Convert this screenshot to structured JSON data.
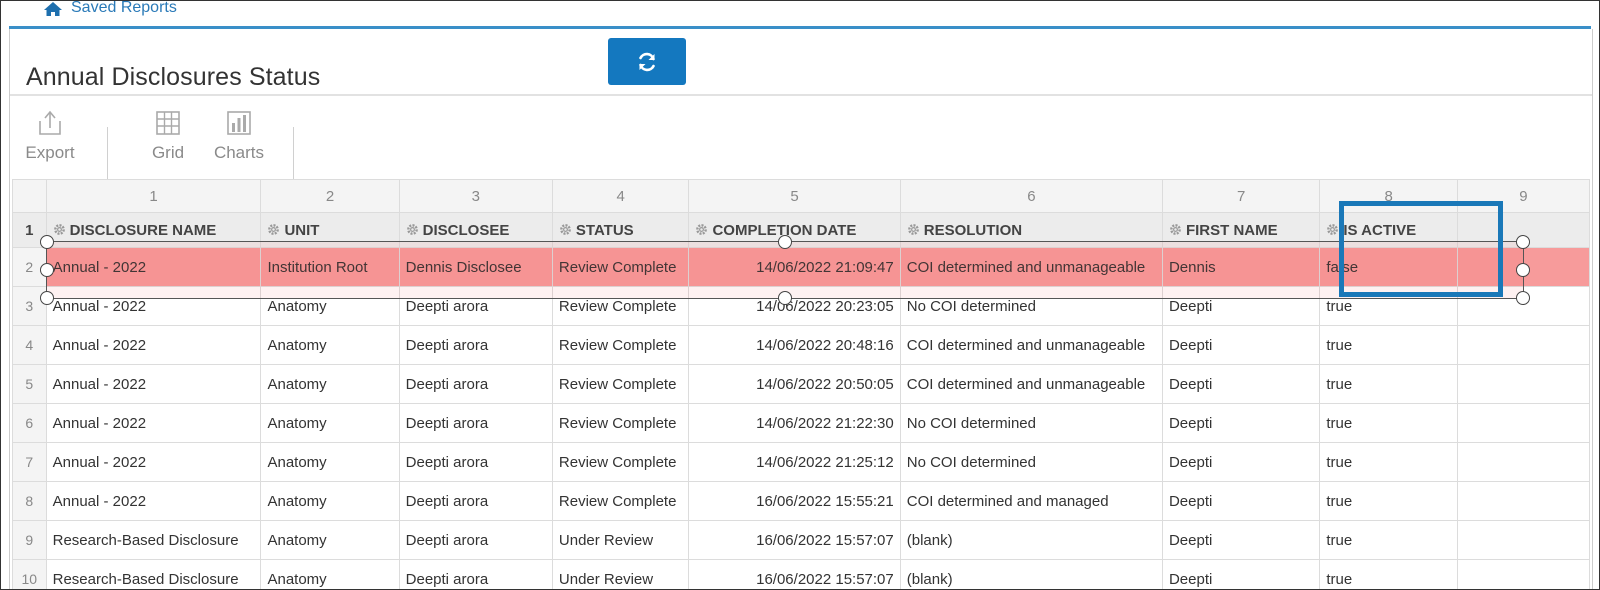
{
  "breadcrumb": {
    "label": "Saved Reports"
  },
  "page": {
    "title": "Annual Disclosures Status"
  },
  "toolbar": {
    "items": [
      {
        "label": "Export",
        "icon": "export-icon"
      },
      {
        "label": "Grid",
        "icon": "grid-icon"
      },
      {
        "label": "Charts",
        "icon": "charts-icon"
      }
    ]
  },
  "colors": {
    "accent": "#1478bf",
    "selected_row": "#f79b9b",
    "highlight": "#1a78b8"
  },
  "grid": {
    "column_numbers": [
      "1",
      "2",
      "3",
      "4",
      "5",
      "6",
      "7",
      "8",
      "9"
    ],
    "headers": [
      "DISCLOSURE NAME",
      "UNIT",
      "DISCLOSEE",
      "STATUS",
      "COMPLETION DATE",
      "RESOLUTION",
      "FIRST NAME",
      "IS ACTIVE"
    ],
    "header_row_number": "1",
    "rows": [
      {
        "num": "2",
        "cells": [
          "Annual - 2022",
          "Institution Root",
          "Dennis Disclosee",
          "Review Complete",
          "14/06/2022 21:09:47",
          "COI determined and unmanageable",
          "Dennis",
          "false"
        ]
      },
      {
        "num": "3",
        "cells": [
          "Annual - 2022",
          "Anatomy",
          "Deepti arora",
          "Review Complete",
          "14/06/2022 20:23:05",
          "No COI determined",
          "Deepti",
          "true"
        ]
      },
      {
        "num": "4",
        "cells": [
          "Annual - 2022",
          "Anatomy",
          "Deepti arora",
          "Review Complete",
          "14/06/2022 20:48:16",
          "COI determined and unmanageable",
          "Deepti",
          "true"
        ]
      },
      {
        "num": "5",
        "cells": [
          "Annual - 2022",
          "Anatomy",
          "Deepti arora",
          "Review Complete",
          "14/06/2022 20:50:05",
          "COI determined and unmanageable",
          "Deepti",
          "true"
        ]
      },
      {
        "num": "6",
        "cells": [
          "Annual - 2022",
          "Anatomy",
          "Deepti arora",
          "Review Complete",
          "14/06/2022 21:22:30",
          "No COI determined",
          "Deepti",
          "true"
        ]
      },
      {
        "num": "7",
        "cells": [
          "Annual - 2022",
          "Anatomy",
          "Deepti arora",
          "Review Complete",
          "14/06/2022 21:25:12",
          "No COI determined",
          "Deepti",
          "true"
        ]
      },
      {
        "num": "8",
        "cells": [
          "Annual - 2022",
          "Anatomy",
          "Deepti arora",
          "Review Complete",
          "16/06/2022 15:55:21",
          "COI determined and managed",
          "Deepti",
          "true"
        ]
      },
      {
        "num": "9",
        "cells": [
          "Research-Based Disclosure",
          "Anatomy",
          "Deepti arora",
          "Under Review",
          "16/06/2022 15:57:07",
          "(blank)",
          "Deepti",
          "true"
        ]
      },
      {
        "num": "10",
        "cells": [
          "Research-Based Disclosure",
          "Anatomy",
          "Deepti arora",
          "Under Review",
          "16/06/2022 15:57:07",
          "(blank)",
          "Deepti",
          "true"
        ]
      }
    ]
  }
}
